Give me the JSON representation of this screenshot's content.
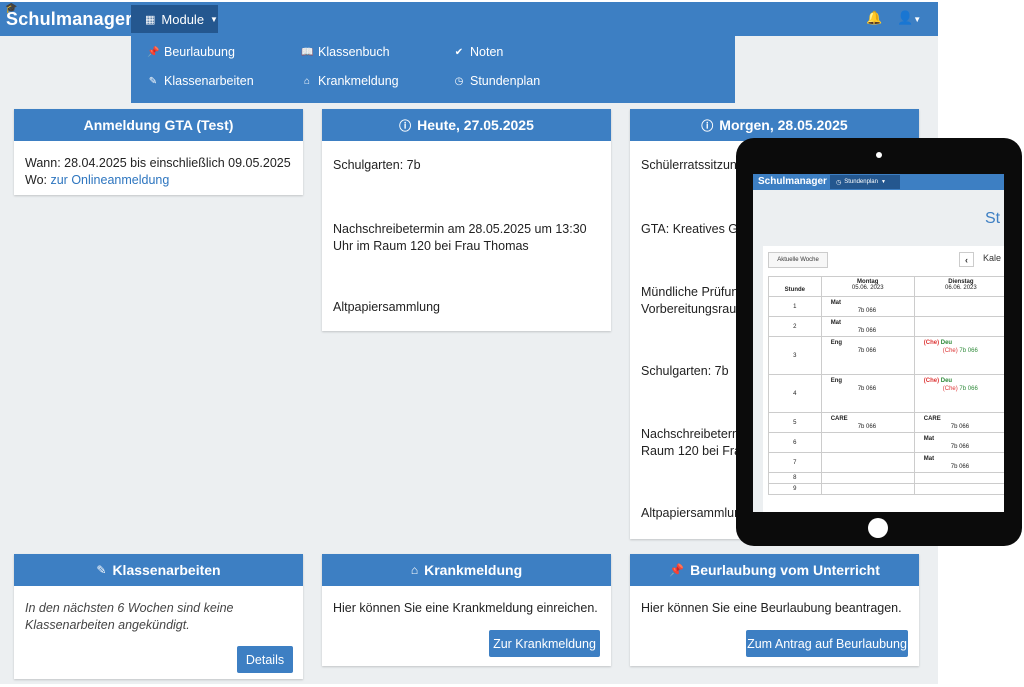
{
  "app": {
    "brand": "Schulmanager",
    "module_label": "Module",
    "dropdown": [
      {
        "label": "Beurlaubung",
        "icon": "pin-icon"
      },
      {
        "label": "Klassenbuch",
        "icon": "book-icon"
      },
      {
        "label": "Noten",
        "icon": "check-circle-icon"
      },
      {
        "label": "Klassenarbeiten",
        "icon": "edit-icon"
      },
      {
        "label": "Krankmeldung",
        "icon": "home-icon"
      },
      {
        "label": "Stundenplan",
        "icon": "clock-icon"
      }
    ]
  },
  "cards": {
    "gta": {
      "title": "Anmeldung GTA (Test)",
      "wann": "Wann: 28.04.2025 bis einschließlich 09.05.2025",
      "wo_prefix": "Wo: ",
      "wo_link": "zur Onlineanmeldung"
    },
    "heute": {
      "title": "Heute, 27.05.2025",
      "events": [
        "Schulgarten: 7b",
        "Nachschreibetermin am 28.05.2025 um 13:30 Uhr im Raum 120 bei Frau Thomas",
        "Altpapiersammlung"
      ]
    },
    "morgen": {
      "title": "Morgen, 28.05.2025",
      "events": [
        "Schülerratssitzung",
        "GTA: Kreatives Gest",
        "Mündliche Prüfung:",
        "Vorbereitungsraum",
        "Schulgarten: 7b",
        "Nachschreibetermin",
        "Raum 120 bei Frau",
        "Altpapiersammlung"
      ]
    },
    "klassenarbeiten": {
      "title": "Klassenarbeiten",
      "text": "In den nächsten 6 Wochen sind keine Klassenarbeiten angekündigt.",
      "button": "Details"
    },
    "krank": {
      "title": "Krankmeldung",
      "text": "Hier können Sie eine Krankmeldung einreichen.",
      "button": "Zur Krankmeldung"
    },
    "beurlaubung": {
      "title": "Beurlaubung vom Unterricht",
      "text": "Hier können Sie eine Beurlaubung beantragen.",
      "button": "Zum Antrag auf Beurlaubung"
    }
  },
  "tablet": {
    "brand": "Schulmanager",
    "module_label": "Stundenplan",
    "title": "St",
    "week_button": "Aktuelle Woche",
    "kalender": "Kale",
    "col_stunde": "Stunde",
    "days": [
      {
        "name": "Montag",
        "date": "05.06. 2023"
      },
      {
        "name": "Dienstag",
        "date": "06.06. 2023"
      }
    ],
    "rows": [
      {
        "n": "1",
        "mon": {
          "s": "Mat",
          "r": "7b 066"
        },
        "tue": null
      },
      {
        "n": "2",
        "mon": {
          "s": "Mat",
          "r": "7b 066"
        },
        "tue": null
      },
      {
        "n": "3",
        "mon": {
          "s": "Eng",
          "r": "7b 066"
        },
        "tue": {
          "pre": "(Che)",
          "s": "Deu",
          "r_pre": "(Che)",
          "r": "7b 066"
        }
      },
      {
        "n": "4",
        "mon": {
          "s": "Eng",
          "r": "7b 066"
        },
        "tue": {
          "pre": "(Che)",
          "s": "Deu",
          "r_pre": "(Che)",
          "r": "7b 066"
        }
      },
      {
        "n": "5",
        "mon": {
          "s": "CARE",
          "r": "7b 066"
        },
        "tue": {
          "s": "CARE",
          "r": "7b 066"
        }
      },
      {
        "n": "6",
        "mon": null,
        "tue": {
          "s": "Mat",
          "r": "7b 066"
        }
      },
      {
        "n": "7",
        "mon": null,
        "tue": {
          "s": "Mat",
          "r": "7b 066"
        }
      },
      {
        "n": "8",
        "mon": null,
        "tue": null
      },
      {
        "n": "9",
        "mon": null,
        "tue": null
      }
    ]
  }
}
